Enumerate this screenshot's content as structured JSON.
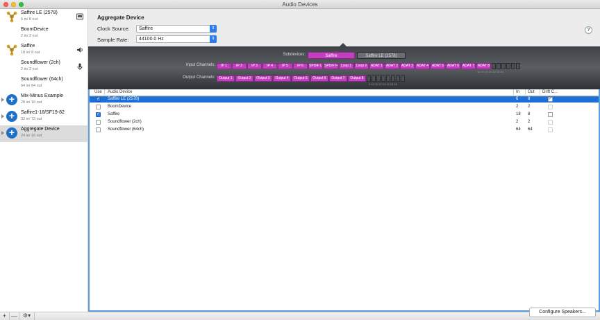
{
  "window": {
    "title": "Audio Devices"
  },
  "sidebar": {
    "devices": [
      {
        "name": "Saffire LE (2578)",
        "sub": "6 in/ 8 out",
        "icon": "firewire-icon",
        "right_icon": "finder-icon",
        "expand": false,
        "plus": false,
        "selected": false
      },
      {
        "name": "BoomDevice",
        "sub": "2 in/ 2 out",
        "icon": "",
        "right_icon": "",
        "expand": false,
        "plus": false,
        "selected": false
      },
      {
        "name": "Saffire",
        "sub": "18 in/ 8 out",
        "icon": "firewire-icon",
        "right_icon": "speaker-icon",
        "expand": false,
        "plus": false,
        "selected": false
      },
      {
        "name": "Soundflower (2ch)",
        "sub": "2 in/ 2 out",
        "icon": "",
        "right_icon": "microphone-icon",
        "expand": false,
        "plus": false,
        "selected": false
      },
      {
        "name": "Soundflower (64ch)",
        "sub": "64 in/ 64 out",
        "icon": "",
        "right_icon": "",
        "expand": false,
        "plus": false,
        "selected": false
      },
      {
        "name": "Mix-Minus Example",
        "sub": "20 in/ 10 out",
        "icon": "",
        "right_icon": "",
        "expand": true,
        "plus": true,
        "selected": false
      },
      {
        "name": "Saffire1-18/SF19-82",
        "sub": "32 in/ 72 out",
        "icon": "",
        "right_icon": "",
        "expand": true,
        "plus": true,
        "selected": false
      },
      {
        "name": "Aggregate Device",
        "sub": "24 in/ 16 out",
        "icon": "",
        "right_icon": "",
        "expand": true,
        "plus": true,
        "selected": true
      }
    ],
    "bottom": {
      "add": "+",
      "remove": "—",
      "gear": "⚙▾"
    }
  },
  "main": {
    "title": "Aggregate Device",
    "clock_source_label": "Clock Source:",
    "clock_source_value": "Saffire",
    "sample_rate_label": "Sample Rate:",
    "sample_rate_value": "44100.0 Hz",
    "help": "?"
  },
  "strip": {
    "subdevices_label": "Subdevices:",
    "subdevices": [
      "Saffire",
      "Saffire LE (2578)"
    ],
    "input_label": "Input Channels:",
    "input_channels": [
      "IP 1",
      "IP 2",
      "IP 3",
      "IP 4",
      "IP 5",
      "IP 6",
      "SPDIF L",
      "SPDIF R",
      "Loop 1",
      "Loop 2",
      "ADAT 1",
      "ADAT 2",
      "ADAT 3",
      "ADAT 4",
      "ADAT 5",
      "ADAT 6",
      "ADAT 7",
      "ADAT 8"
    ],
    "input_empty": 6,
    "input_ticks": "18 19 20 21 22 23 24",
    "output_label": "Output Channels:",
    "output_channels": [
      "Output 1",
      "Output 2",
      "Output 3",
      "Output 4",
      "Output 5",
      "Output 6",
      "Output 7",
      "Output 8"
    ],
    "output_empty": 8,
    "output_ticks": "9 10 11 12 13 14 15 16"
  },
  "table": {
    "headers": {
      "use": "Use",
      "device": "Audio Device",
      "in": "In",
      "out": "Out",
      "drift": "Drift C..."
    },
    "rows": [
      {
        "use": true,
        "device": "Saffire LE (2578)",
        "in": "6",
        "out": "8",
        "drift": true,
        "drift_enabled": true,
        "selected": true
      },
      {
        "use": false,
        "device": "BoomDevice",
        "in": "2",
        "out": "2",
        "drift": false,
        "drift_enabled": false,
        "selected": false
      },
      {
        "use": true,
        "device": "Saffire",
        "in": "18",
        "out": "8",
        "drift": false,
        "drift_enabled": true,
        "selected": false
      },
      {
        "use": false,
        "device": "Soundflower (2ch)",
        "in": "2",
        "out": "2",
        "drift": false,
        "drift_enabled": false,
        "selected": false
      },
      {
        "use": false,
        "device": "Soundflower (64ch)",
        "in": "64",
        "out": "64",
        "drift": false,
        "drift_enabled": false,
        "selected": false
      }
    ]
  },
  "configure_button": "Configure Speakers...",
  "colors": {
    "accent": "#2e7ce6",
    "channel": "#c43ec0",
    "selection": "#1c6fd6"
  }
}
